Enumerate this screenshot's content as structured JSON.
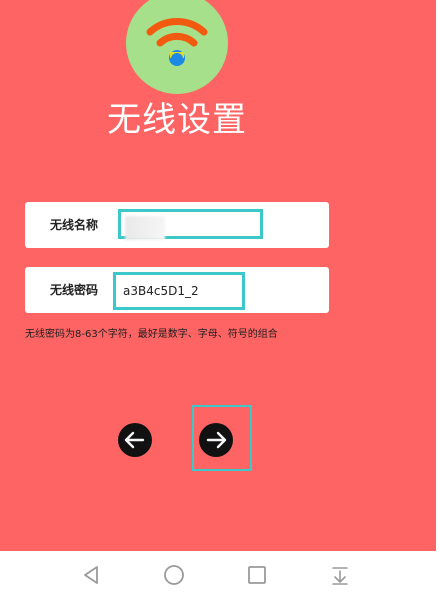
{
  "header": {
    "logo_icon": "wifi-icon",
    "title": "无线设置"
  },
  "form": {
    "ssid_label": "无线名称",
    "ssid_value": "",
    "password_label": "无线密码",
    "password_value": "a3B4c5D1_2",
    "hint": "无线密码为8-63个字符，最好是数字、字母、符号的组合"
  },
  "navigation": {
    "back_icon": "arrow-left-icon",
    "next_icon": "arrow-right-icon"
  },
  "system_bar": {
    "back_icon": "triangle-back-icon",
    "home_icon": "circle-home-icon",
    "recents_icon": "square-recents-icon",
    "notification_icon": "pull-down-icon"
  },
  "colors": {
    "background": "#fe6464",
    "logo_circle": "#a6e08a",
    "wifi_arc": "#f25a0f",
    "wifi_dot": "#1e88e5",
    "highlight": "#3cc7c9"
  }
}
